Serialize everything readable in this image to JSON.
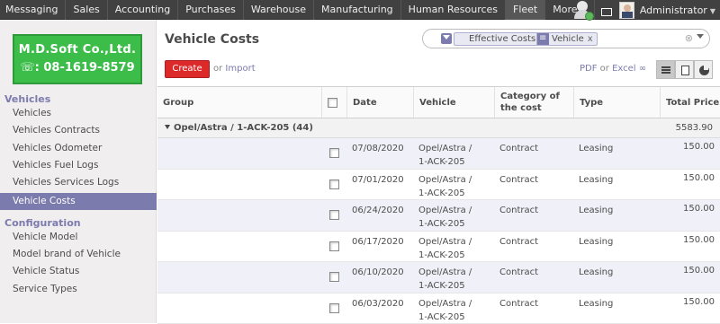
{
  "topbar": {
    "menu": [
      "Messaging",
      "Sales",
      "Accounting",
      "Purchases",
      "Warehouse",
      "Manufacturing",
      "Human Resources",
      "Fleet",
      "More"
    ],
    "active": "Fleet",
    "user_name": "Administrator"
  },
  "sidebar": {
    "logo": {
      "company": "M.D.Soft Co.,Ltd.",
      "phone": "08-1619-8579"
    },
    "section_vehicles": "Vehicles",
    "vehicle_items": [
      "Vehicles",
      "Vehicles Contracts",
      "Vehicles Odometer",
      "Vehicles Fuel Logs",
      "Vehicles Services Logs",
      "Vehicle Costs"
    ],
    "section_config": "Configuration",
    "config_items": [
      "Vehicle Model",
      "Model brand of Vehicle",
      "Vehicle Status",
      "Service Types"
    ]
  },
  "main": {
    "title": "Vehicle Costs",
    "search": {
      "facets": [
        "Effective Costs",
        "Vehicle"
      ],
      "clear": "⊗"
    },
    "create_label": "Create",
    "or_text": "or",
    "import_label": "Import",
    "pdf_label": "PDF",
    "excel_label": "Excel",
    "columns": [
      "Group",
      "",
      "Date",
      "Vehicle",
      "Category of the cost",
      "Type",
      "Total Price"
    ],
    "group": {
      "label": "Opel/Astra / 1-ACK-205 (44)",
      "total": "5583.90"
    },
    "rows": [
      {
        "date": "07/08/2020",
        "vehicle_l1": "Opel/Astra /",
        "vehicle_l2": "1-ACK-205",
        "category": "Contract",
        "type": "Leasing",
        "price": "150.00"
      },
      {
        "date": "07/01/2020",
        "vehicle_l1": "Opel/Astra /",
        "vehicle_l2": "1-ACK-205",
        "category": "Contract",
        "type": "Leasing",
        "price": "150.00"
      },
      {
        "date": "06/24/2020",
        "vehicle_l1": "Opel/Astra /",
        "vehicle_l2": "1-ACK-205",
        "category": "Contract",
        "type": "Leasing",
        "price": "150.00"
      },
      {
        "date": "06/17/2020",
        "vehicle_l1": "Opel/Astra /",
        "vehicle_l2": "1-ACK-205",
        "category": "Contract",
        "type": "Leasing",
        "price": "150.00"
      },
      {
        "date": "06/10/2020",
        "vehicle_l1": "Opel/Astra /",
        "vehicle_l2": "1-ACK-205",
        "category": "Contract",
        "type": "Leasing",
        "price": "150.00"
      },
      {
        "date": "06/03/2020",
        "vehicle_l1": "Opel/Astra /",
        "vehicle_l2": "1-ACK-205",
        "category": "Contract",
        "type": "Leasing",
        "price": "150.00"
      }
    ]
  },
  "colors": {
    "accent": "#7c7bad",
    "create": "#dc2a2a",
    "logo_bg": "#3cbd4a",
    "topbar": "#414141"
  }
}
